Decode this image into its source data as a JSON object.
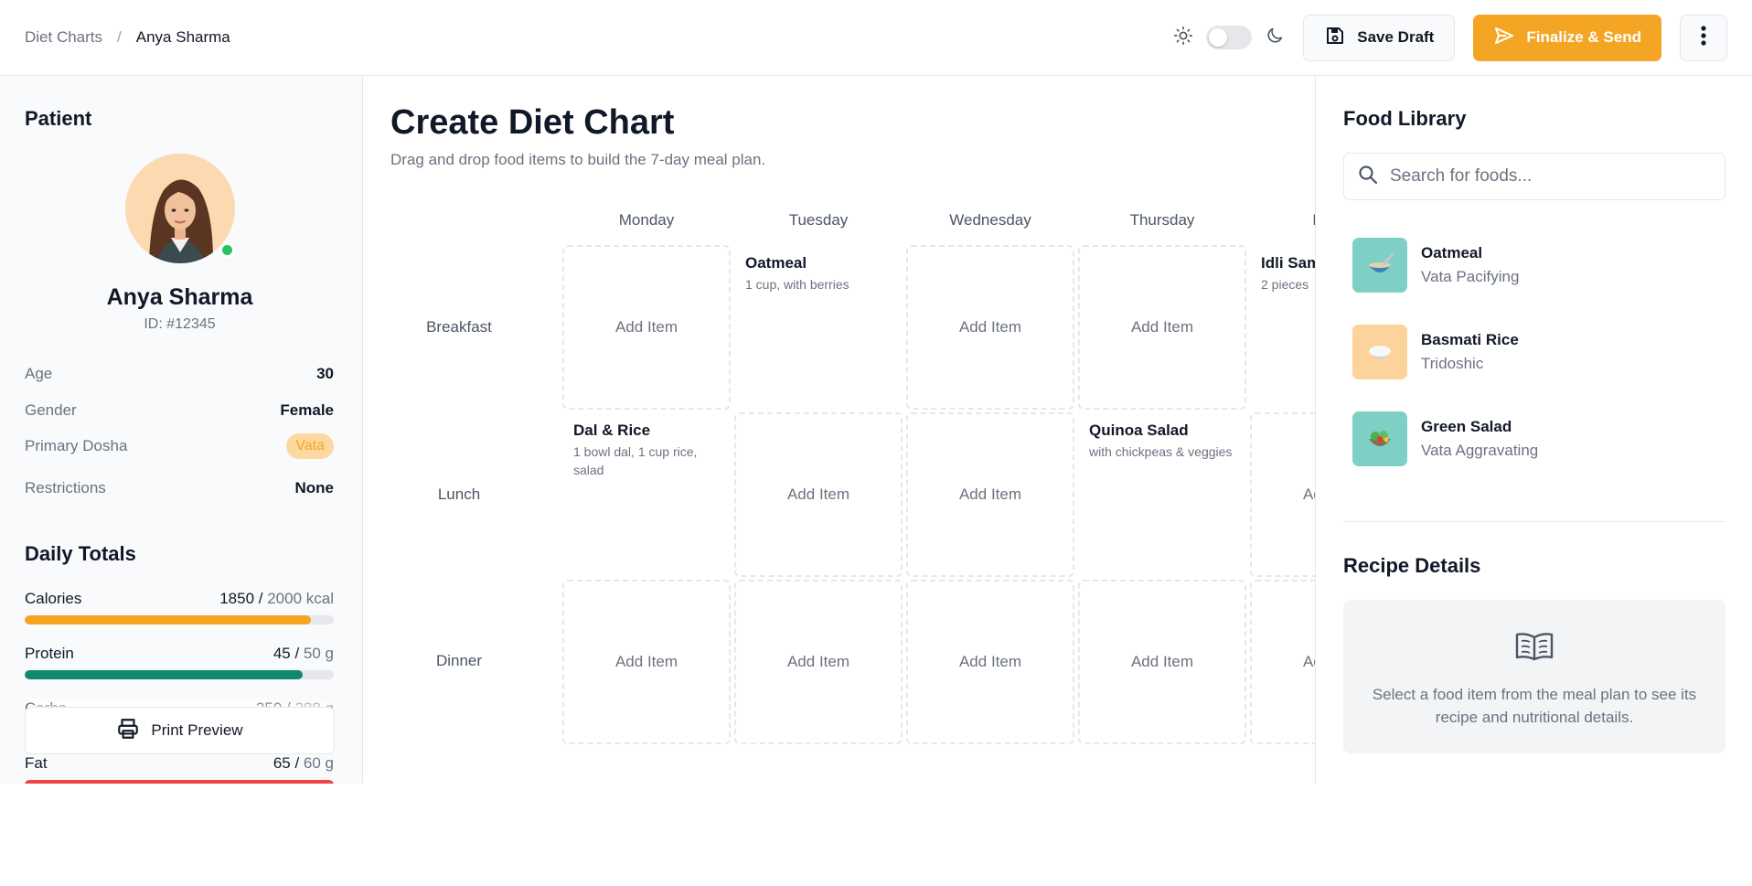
{
  "header": {
    "breadcrumb": {
      "parent": "Diet Charts",
      "separator": "/",
      "current": "Anya Sharma"
    },
    "theme": {
      "light_icon": "sun-icon",
      "dark_icon": "moon-icon",
      "dark_mode": false
    },
    "save_draft": {
      "label": "Save Draft",
      "icon": "save-icon"
    },
    "finalize": {
      "label": "Finalize & Send",
      "icon": "send-icon"
    },
    "more_icon": "more-vertical-icon"
  },
  "patient": {
    "section_title": "Patient",
    "name": "Anya Sharma",
    "id": "ID: #12345",
    "online": true,
    "details": [
      {
        "label": "Age",
        "value": "30"
      },
      {
        "label": "Gender",
        "value": "Female"
      },
      {
        "label": "Primary Dosha",
        "value": "Vata"
      },
      {
        "label": "Restrictions",
        "value": "None"
      }
    ]
  },
  "daily_totals": {
    "title": "Daily Totals",
    "items": [
      {
        "name": "Calories",
        "current": "1850",
        "goal": "2000 kcal",
        "progress": 0.925,
        "color": "#f5a524"
      },
      {
        "name": "Protein",
        "current": "45",
        "goal": "50 g",
        "progress": 0.9,
        "color": "#0f8a6f"
      },
      {
        "name": "Carbs",
        "current": "250",
        "goal": "280 g",
        "progress": 0.89,
        "color": "#0f8a6f"
      },
      {
        "name": "Fat",
        "current": "65",
        "goal": "60 g",
        "progress": 1.0,
        "color": "#ef4444"
      }
    ],
    "print_label": "Print Preview"
  },
  "main": {
    "title": "Create Diet Chart",
    "subtitle": "Drag and drop food items to build the 7-day meal plan.",
    "days": [
      "Monday",
      "Tuesday",
      "Wednesday",
      "Thursday",
      "Friday"
    ],
    "meals": [
      "Breakfast",
      "Lunch",
      "Dinner"
    ],
    "empty_label": "Add Item",
    "items": {
      "breakfast_tuesday": {
        "name": "Oatmeal",
        "desc": "1 cup, with berries"
      },
      "breakfast_friday": {
        "name": "Idli Sambar",
        "desc": "2 pieces"
      },
      "lunch_monday": {
        "name": "Dal & Rice",
        "desc": "1 bowl dal, 1 cup rice, salad"
      },
      "lunch_thursday": {
        "name": "Quinoa Salad",
        "desc": "with chickpeas & veggies"
      }
    }
  },
  "library": {
    "title": "Food Library",
    "search_placeholder": "Search for foods...",
    "foods": [
      {
        "name": "Oatmeal",
        "tag": "Vata Pacifying",
        "icon": "oatmeal-bowl-icon",
        "bg": "#7fd0c4"
      },
      {
        "name": "Basmati Rice",
        "tag": "Tridoshic",
        "icon": "rice-bowl-icon",
        "bg": "#fcd39a"
      },
      {
        "name": "Green Salad",
        "tag": "Vata Aggravating",
        "icon": "salad-icon",
        "bg": "#7fd0c4"
      }
    ]
  },
  "recipe": {
    "title": "Recipe Details",
    "icon": "open-book-icon",
    "empty_text": "Select a food item from the meal plan to see its recipe and nutritional details."
  }
}
